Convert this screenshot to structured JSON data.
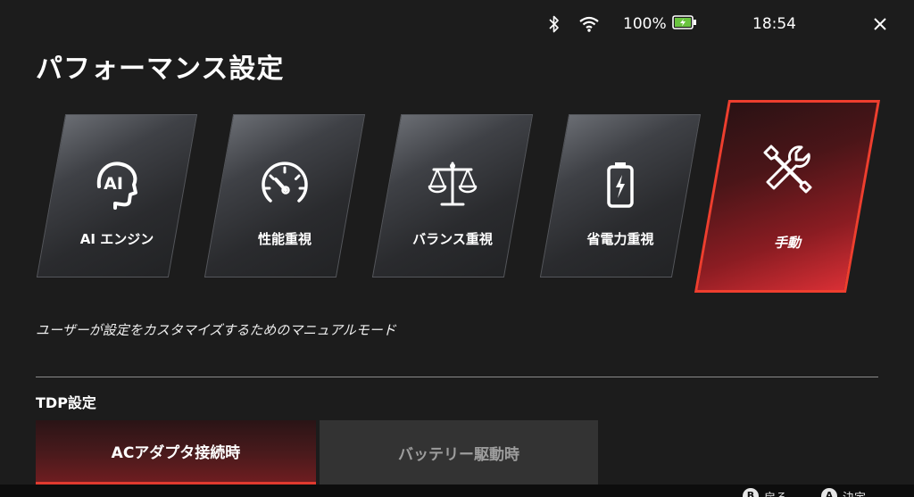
{
  "status": {
    "bluetooth_icon": "bluetooth-icon",
    "wifi_icon": "wifi-icon",
    "battery_percent": "100%",
    "battery_icon": "battery-charging-icon",
    "time": "18:54",
    "close_icon": "close-icon"
  },
  "page": {
    "title": "パフォーマンス設定"
  },
  "modes": [
    {
      "label": "AI エンジン",
      "icon": "ai-head-icon",
      "selected": false
    },
    {
      "label": "性能重視",
      "icon": "speedometer-icon",
      "selected": false
    },
    {
      "label": "バランス重視",
      "icon": "balance-scale-icon",
      "selected": false
    },
    {
      "label": "省電力重視",
      "icon": "battery-icon",
      "selected": false
    },
    {
      "label": "手動",
      "icon": "wrench-screwdriver-icon",
      "selected": true
    }
  ],
  "description": "ユーザーが設定をカスタマイズするためのマニュアルモード",
  "tdp": {
    "title": "TDP設定",
    "tabs": [
      {
        "label": "ACアダプタ接続時",
        "selected": true
      },
      {
        "label": "バッテリー駆動時",
        "selected": false
      }
    ]
  },
  "footer": {
    "hints": [
      {
        "button": "B",
        "label": "戻る"
      },
      {
        "button": "A",
        "label": "決定"
      }
    ]
  },
  "colors": {
    "accent": "#e03a2f",
    "background": "#1c1c1c",
    "battery_fill": "#6ac43f"
  }
}
